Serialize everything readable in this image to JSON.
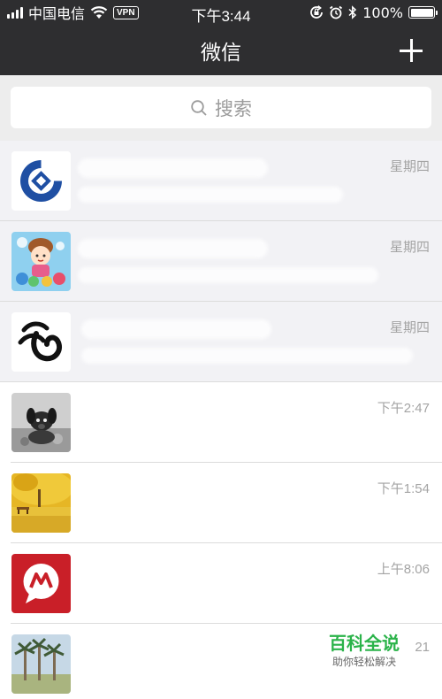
{
  "status_bar": {
    "carrier": "中国电信",
    "vpn": "VPN",
    "time": "下午3:44",
    "battery": "100%",
    "battery_level": 1.0
  },
  "nav": {
    "title": "微信",
    "add_icon": "plus-icon"
  },
  "search": {
    "placeholder": "搜索",
    "icon": "search-icon"
  },
  "chats": [
    {
      "time": "星期四",
      "pinned": true,
      "avatar": "bank-logo"
    },
    {
      "time": "星期四",
      "pinned": true,
      "avatar": "cartoon-girl"
    },
    {
      "time": "星期四",
      "pinned": true,
      "avatar": "ink-logo"
    },
    {
      "time": "下午2:47",
      "pinned": false,
      "avatar": "dog-photo"
    },
    {
      "time": "下午1:54",
      "pinned": false,
      "avatar": "autumn-tree-photo"
    },
    {
      "time": "上午8:06",
      "pinned": false,
      "avatar": "red-chat-logo"
    },
    {
      "time": "21",
      "pinned": false,
      "avatar": "palm-trees-photo"
    }
  ],
  "watermark": {
    "title": "百科全说",
    "subtitle": "助你轻松解决"
  },
  "colors": {
    "nav_bg": "#2e2e30",
    "pinned_bg": "#f2f2f5",
    "watermark_green": "#2bb34a"
  }
}
